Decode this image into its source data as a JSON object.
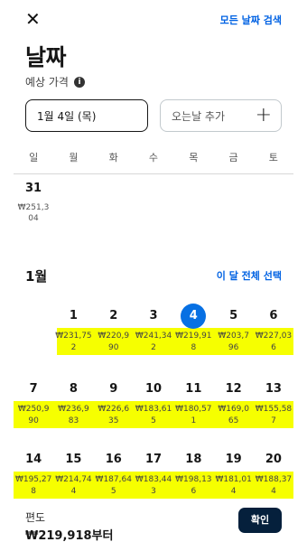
{
  "header": {
    "close_icon": "close-icon",
    "search_all": "모든 날짜 검색"
  },
  "title": "날짜",
  "subtitle": "예상 가격",
  "info_icon": "i",
  "departure": "1월 4일 (목)",
  "return_placeholder": "오는날 추가",
  "plus_icon": "+",
  "weekdays": [
    "일",
    "월",
    "화",
    "수",
    "목",
    "금",
    "토"
  ],
  "prev_month": {
    "day": "31",
    "price_l1": "₩251,3",
    "price_l2": "04"
  },
  "month": {
    "label": "1월",
    "select_all": "이 달 전체 선택"
  },
  "weeks": [
    [
      {
        "day": "1",
        "p1": "₩231,75",
        "p2": "2"
      },
      {
        "day": "2",
        "p1": "₩220,9",
        "p2": "90"
      },
      {
        "day": "3",
        "p1": "₩241,34",
        "p2": "2"
      },
      {
        "day": "4",
        "p1": "₩219,91",
        "p2": "8"
      },
      {
        "day": "5",
        "p1": "₩203,7",
        "p2": "96"
      },
      {
        "day": "6",
        "p1": "₩227,03",
        "p2": "6"
      }
    ],
    [
      {
        "day": "7",
        "p1": "₩250,9",
        "p2": "90"
      },
      {
        "day": "8",
        "p1": "₩236,9",
        "p2": "83"
      },
      {
        "day": "9",
        "p1": "₩226,6",
        "p2": "35"
      },
      {
        "day": "10",
        "p1": "₩183,61",
        "p2": "5"
      },
      {
        "day": "11",
        "p1": "₩180,57",
        "p2": "1"
      },
      {
        "day": "12",
        "p1": "₩169,0",
        "p2": "65"
      },
      {
        "day": "13",
        "p1": "₩155,58",
        "p2": "7"
      }
    ],
    [
      {
        "day": "14",
        "p1": "₩195,27",
        "p2": "8"
      },
      {
        "day": "15",
        "p1": "₩214,74",
        "p2": "4"
      },
      {
        "day": "16",
        "p1": "₩187,64",
        "p2": "5"
      },
      {
        "day": "17",
        "p1": "₩183,44",
        "p2": "3"
      },
      {
        "day": "18",
        "p1": "₩198,13",
        "p2": "6"
      },
      {
        "day": "19",
        "p1": "₩181,01",
        "p2": "4"
      },
      {
        "day": "20",
        "p1": "₩188,37",
        "p2": "4"
      }
    ]
  ],
  "footer": {
    "label": "편도",
    "price": "₩219,918부터",
    "confirm": "확인"
  },
  "colors": {
    "accent": "#0062e3",
    "selected": "#0770e3",
    "highlight": "#f6ff00",
    "button": "#05203c"
  }
}
